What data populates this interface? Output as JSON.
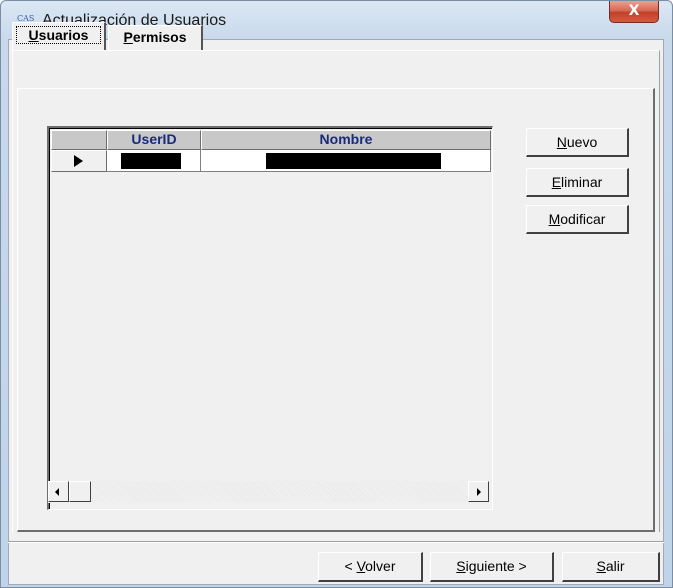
{
  "window": {
    "icon_text": "CAS",
    "title": "Actualización de Usuarios",
    "close_label": "X"
  },
  "tabs": [
    {
      "label_first": "U",
      "label_rest": "suarios",
      "selected": true
    },
    {
      "label_first": "P",
      "label_rest": "ermisos",
      "selected": false
    }
  ],
  "grid": {
    "columns": [
      "UserID",
      "Nombre"
    ],
    "rows": [
      {
        "userid": "",
        "nombre": "",
        "redacted": true
      }
    ]
  },
  "buttons": {
    "nuevo": {
      "first": "N",
      "rest": "uevo"
    },
    "eliminar": {
      "first": "E",
      "rest": "liminar"
    },
    "modificar": {
      "first": "M",
      "rest": "odificar"
    },
    "volver": {
      "pre": "< ",
      "first": "V",
      "rest": "olver"
    },
    "siguiente": {
      "first": "S",
      "rest": "iguiente >"
    },
    "salir": {
      "first": "S",
      "rest": "alir"
    }
  },
  "icons": [
    "app-icon",
    "close-icon",
    "row-pointer-icon",
    "scroll-left-icon",
    "scroll-right-icon"
  ]
}
